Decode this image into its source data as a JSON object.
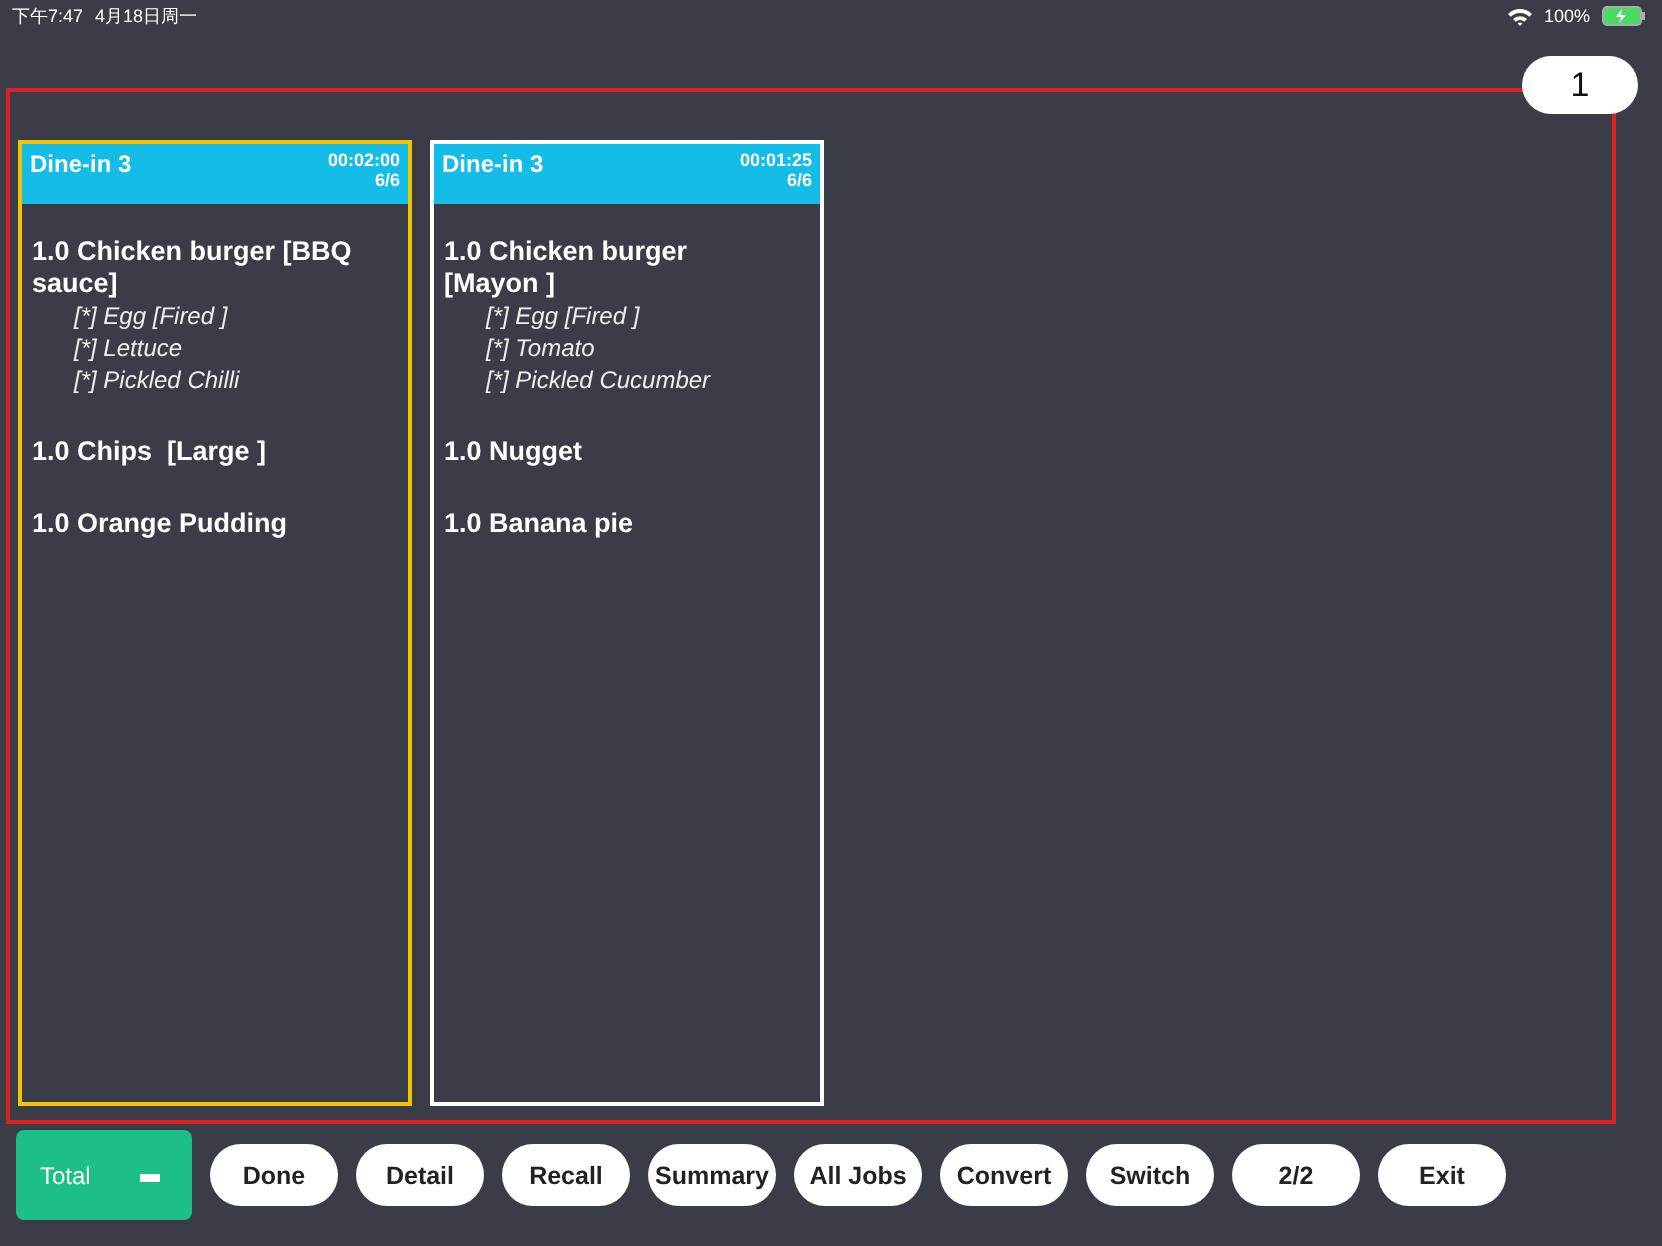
{
  "status_bar": {
    "time": "下午7:47",
    "date": "4月18日周一",
    "battery": "100%"
  },
  "page_badge": "1",
  "orders": [
    {
      "title": "Dine-in 3",
      "timer": "00:02:00",
      "count": "6/6",
      "selected": true,
      "items": [
        {
          "name": "1.0 Chicken burger [BBQ sauce]",
          "modifiers": [
            "[*] Egg [Fired ]",
            "[*] Lettuce",
            "[*] Pickled Chilli"
          ]
        },
        {
          "name": "1.0 Chips  [Large ]"
        },
        {
          "name": "1.0 Orange Pudding"
        }
      ]
    },
    {
      "title": "Dine-in 3",
      "timer": "00:01:25",
      "count": "6/6",
      "selected": false,
      "items": [
        {
          "name": "1.0 Chicken burger [Mayon ]",
          "modifiers": [
            "[*] Egg [Fired ]",
            "[*] Tomato",
            "[*] Pickled Cucumber"
          ]
        },
        {
          "name": "1.0 Nugget"
        },
        {
          "name": "1.0 Banana pie"
        }
      ]
    }
  ],
  "total_button": "Total",
  "buttons": [
    "Done",
    "Detail",
    "Recall",
    "Summary",
    "All Jobs",
    "Convert",
    "Switch",
    "2/2",
    "Exit"
  ]
}
